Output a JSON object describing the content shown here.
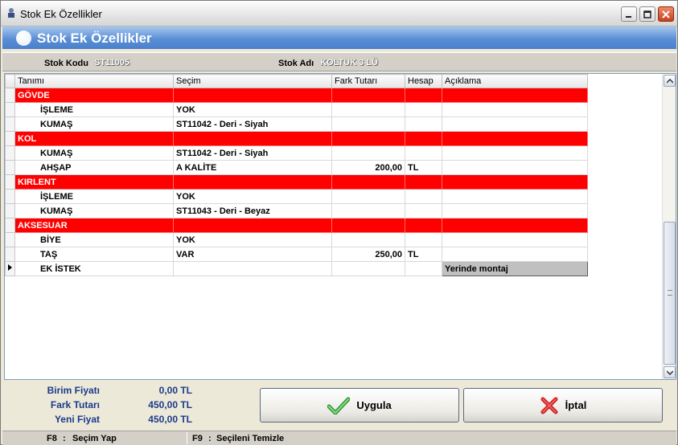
{
  "window": {
    "title": "Stok Ek Özellikler"
  },
  "header": {
    "title": "Stok Ek Özellikler"
  },
  "info": {
    "stok_kodu_label": "Stok Kodu",
    "stok_kodu_value": "ST11005",
    "stok_adi_label": "Stok Adı",
    "stok_adi_value": "KOLTUK 3 LÜ"
  },
  "grid": {
    "columns": [
      "Tanımı",
      "Seçim",
      "Fark Tutarı",
      "Hesap",
      "Açıklama"
    ],
    "rows": [
      {
        "group": true,
        "tanimi": "GÖVDE",
        "secim": "",
        "fark": "",
        "hesap": "",
        "aciklama": ""
      },
      {
        "group": false,
        "tanimi": "İŞLEME",
        "secim": "YOK",
        "fark": "",
        "hesap": "",
        "aciklama": ""
      },
      {
        "group": false,
        "tanimi": "KUMAŞ",
        "secim": "ST11042 - Deri - Siyah",
        "fark": "",
        "hesap": "",
        "aciklama": ""
      },
      {
        "group": true,
        "tanimi": "KOL",
        "secim": "",
        "fark": "",
        "hesap": "",
        "aciklama": ""
      },
      {
        "group": false,
        "tanimi": "KUMAŞ",
        "secim": "ST11042 - Deri - Siyah",
        "fark": "",
        "hesap": "",
        "aciklama": ""
      },
      {
        "group": false,
        "tanimi": "AHŞAP",
        "secim": "A KALİTE",
        "fark": "200,00",
        "hesap": "TL",
        "aciklama": ""
      },
      {
        "group": true,
        "tanimi": "KIRLENT",
        "secim": "",
        "fark": "",
        "hesap": "",
        "aciklama": ""
      },
      {
        "group": false,
        "tanimi": "İŞLEME",
        "secim": "YOK",
        "fark": "",
        "hesap": "",
        "aciklama": ""
      },
      {
        "group": false,
        "tanimi": "KUMAŞ",
        "secim": "ST11043 - Deri - Beyaz",
        "fark": "",
        "hesap": "",
        "aciklama": ""
      },
      {
        "group": true,
        "tanimi": "AKSESUAR",
        "secim": "",
        "fark": "",
        "hesap": "",
        "aciklama": ""
      },
      {
        "group": false,
        "tanimi": "BİYE",
        "secim": "YOK",
        "fark": "",
        "hesap": "",
        "aciklama": ""
      },
      {
        "group": false,
        "tanimi": "TAŞ",
        "secim": "VAR",
        "fark": "250,00",
        "hesap": "TL",
        "aciklama": ""
      },
      {
        "group": false,
        "current": true,
        "tanimi": "EK İSTEK",
        "secim": "",
        "fark": "",
        "hesap": "",
        "aciklama": "Yerinde montaj"
      }
    ]
  },
  "totals": {
    "birim_label": "Birim Fiyatı",
    "birim_value": "0,00 TL",
    "fark_label": "Fark Tutarı",
    "fark_value": "450,00 TL",
    "yeni_label": "Yeni Fiyat",
    "yeni_value": "450,00 TL"
  },
  "buttons": {
    "apply_label": "Uygula",
    "cancel_label": "İptal"
  },
  "status": {
    "f8_key": "F8",
    "f8_text": "Seçim Yap",
    "f9_key": "F9",
    "f9_text": "Seçileni Temizle"
  },
  "colors": {
    "group_row": "#ff0000",
    "header_band": "#5a8fd6",
    "totals_text": "#1c3a8a"
  }
}
